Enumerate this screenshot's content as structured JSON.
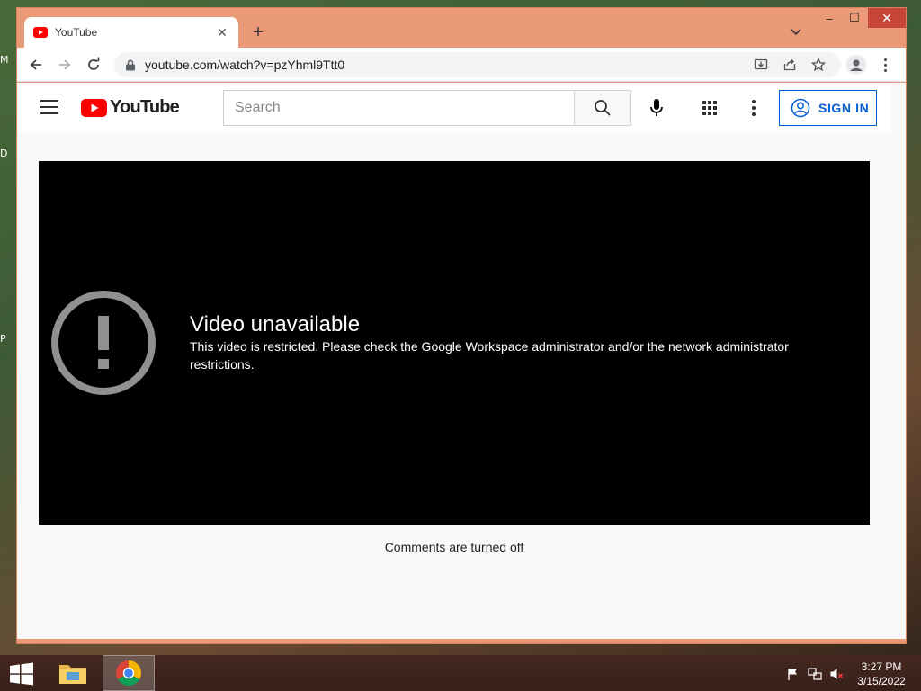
{
  "desktop": {
    "edge_letters": [
      "M",
      "D",
      "P"
    ]
  },
  "browser": {
    "tab": {
      "title": "YouTube"
    },
    "new_tab_glyph": "+",
    "window_controls": {
      "minimize": "–",
      "maximize": "☐",
      "close": "✕"
    },
    "address": {
      "url": "youtube.com/watch?v=pzYhml9Ttt0"
    }
  },
  "youtube": {
    "logo_text": "YouTube",
    "search": {
      "placeholder": "Search"
    },
    "sign_in_label": "SIGN IN",
    "brand_red": "#ff0000",
    "link_blue": "#065fd4"
  },
  "player": {
    "error_title": "Video unavailable",
    "error_message": "This video is restricted. Please check the Google Workspace administrator and/or the network administrator restrictions."
  },
  "comments": {
    "status": "Comments are turned off"
  },
  "taskbar": {
    "clock_time": "3:27 PM",
    "clock_date": "3/15/2022"
  }
}
